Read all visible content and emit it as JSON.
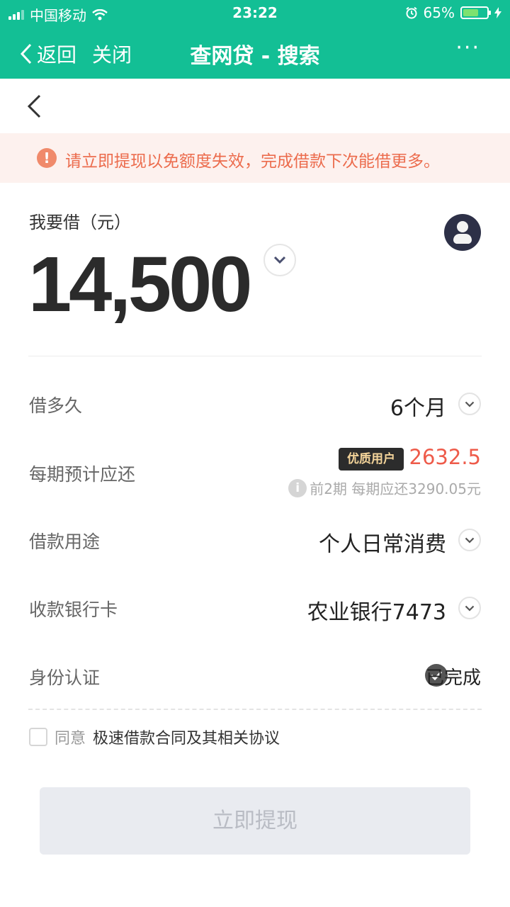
{
  "status_bar": {
    "carrier": "中国移动",
    "time": "23:22",
    "battery_percent": "65%",
    "battery_level": 0.65
  },
  "nav": {
    "back_label": "返回",
    "close_label": "关闭",
    "title": "查网贷 - 搜索",
    "more_label": "···"
  },
  "notice": {
    "icon_text": "!",
    "text": "请立即提现以免额度失效，完成借款下次能借更多。"
  },
  "loan": {
    "label": "我要借（元）",
    "amount": "14,500"
  },
  "rows": {
    "term": {
      "label": "借多久",
      "value": "6个月"
    },
    "repayment": {
      "label": "每期预计应还",
      "badge": "优质用户",
      "value": "2632.5",
      "info_icon": "i",
      "note": "前2期 每期应还3290.05元"
    },
    "purpose": {
      "label": "借款用途",
      "value": "个人日常消费"
    },
    "bank_card": {
      "label": "收款银行卡",
      "value": "农业银行7473"
    },
    "identity": {
      "label": "身份认证",
      "value": "已完成"
    }
  },
  "agreement": {
    "prefix": "同意",
    "link": "极速借款合同及其相关协议"
  },
  "submit_label": "立即提现",
  "colors": {
    "header_bg": "#13bf95",
    "notice_bg": "#fdf1ee",
    "notice_text": "#ec6c4d",
    "repay_value": "#ee5b4a",
    "submit_bg": "#e9ebf0"
  }
}
